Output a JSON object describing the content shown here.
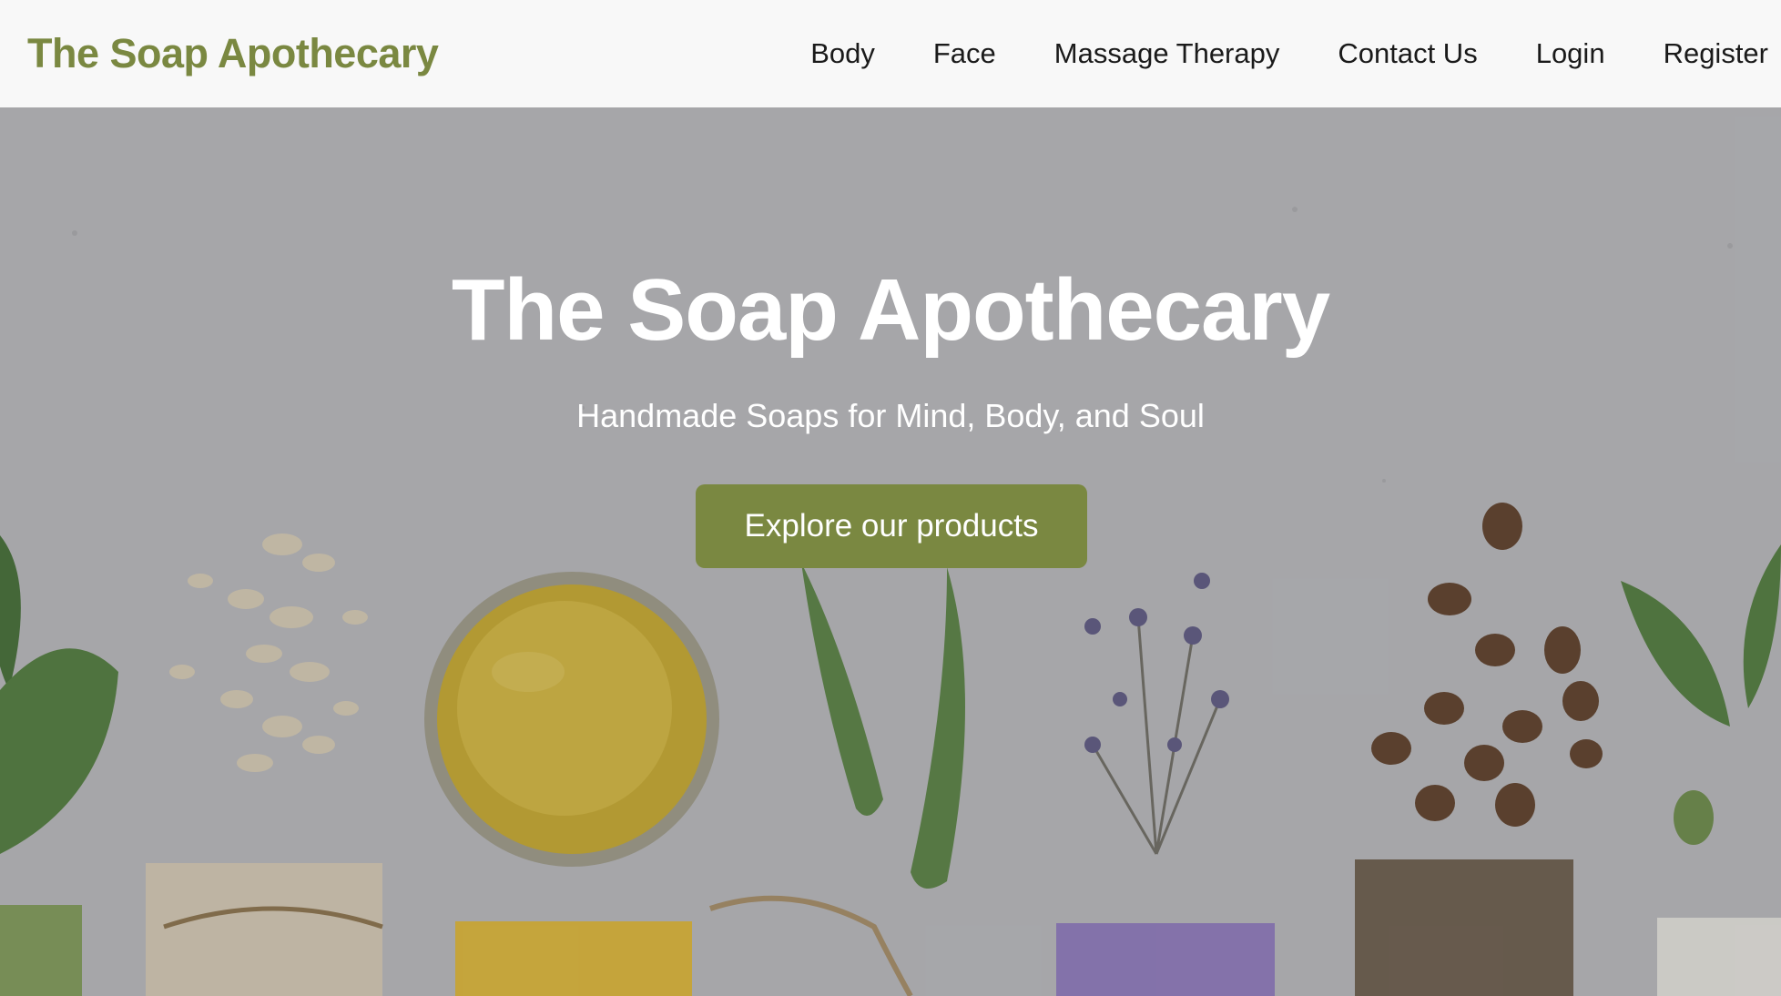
{
  "navbar": {
    "brand": "The Soap Apothecary",
    "links": [
      {
        "label": "Body"
      },
      {
        "label": "Face"
      },
      {
        "label": "Massage Therapy"
      },
      {
        "label": "Contact Us"
      },
      {
        "label": "Login"
      },
      {
        "label": "Register"
      }
    ]
  },
  "hero": {
    "title": "The Soap Apothecary",
    "subtitle": "Handmade Soaps for Mind, Body, and Soul",
    "cta_label": "Explore our products",
    "background": "flat-lay of soap ingredients: leaves, oats, oil jar, aloe, lavender, coffee beans, soap bars"
  },
  "colors": {
    "brand": "#7a8841",
    "nav_bg": "#f8f8f8",
    "hero_text": "#ffffff",
    "button_bg": "#7a8841"
  }
}
